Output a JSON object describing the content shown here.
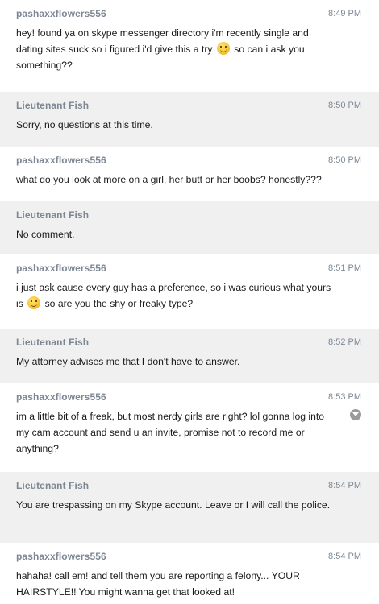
{
  "messages": [
    {
      "sender": "pashaxxflowers556",
      "time": "8:49 PM",
      "text_a": "hey! found ya on skype messenger directory i'm recently single and dating sites suck so i figured i'd give this a try",
      "emoji_icon": "wink-emoji-icon",
      "text_b": " so can i ask you something??"
    },
    {
      "sender": "Lieutenant Fish",
      "time": "8:50 PM",
      "text": "Sorry, no questions at this time."
    },
    {
      "sender": "pashaxxflowers556",
      "time": "8:50 PM",
      "text": "what do you look at more on a girl, her butt or her boobs? honestly???"
    },
    {
      "sender": "Lieutenant Fish",
      "time": "",
      "text": "No comment."
    },
    {
      "sender": "pashaxxflowers556",
      "time": "8:51 PM",
      "text_a": "i just ask cause every guy has a preference, so i was curious what yours is",
      "emoji_icon": "smile-emoji-icon",
      "text_b": " so are you the shy or freaky type?"
    },
    {
      "sender": "Lieutenant Fish",
      "time": "8:52 PM",
      "text": "My attorney advises me that I don't have to answer."
    },
    {
      "sender": "pashaxxflowers556",
      "time": "8:53 PM",
      "text": "im a little bit of a freak, but most nerdy girls are right? lol gonna log into my cam account and send u an invite, promise not to record me or anything?"
    },
    {
      "sender": "Lieutenant Fish",
      "time": "8:54 PM",
      "text": "You are trespassing on my Skype account. Leave or I will call the police."
    },
    {
      "sender": "pashaxxflowers556",
      "time": "8:54 PM",
      "text": "hahaha!  call em! and tell them you are reporting a felony...  YOUR HAIRSTYLE!!  You might wanna get that looked at!"
    }
  ],
  "colors": {
    "incoming_bg": "#ffffff",
    "outgoing_bg": "#f0f0f0",
    "meta_text": "#7d8794",
    "body_text": "#1a1a1a"
  }
}
